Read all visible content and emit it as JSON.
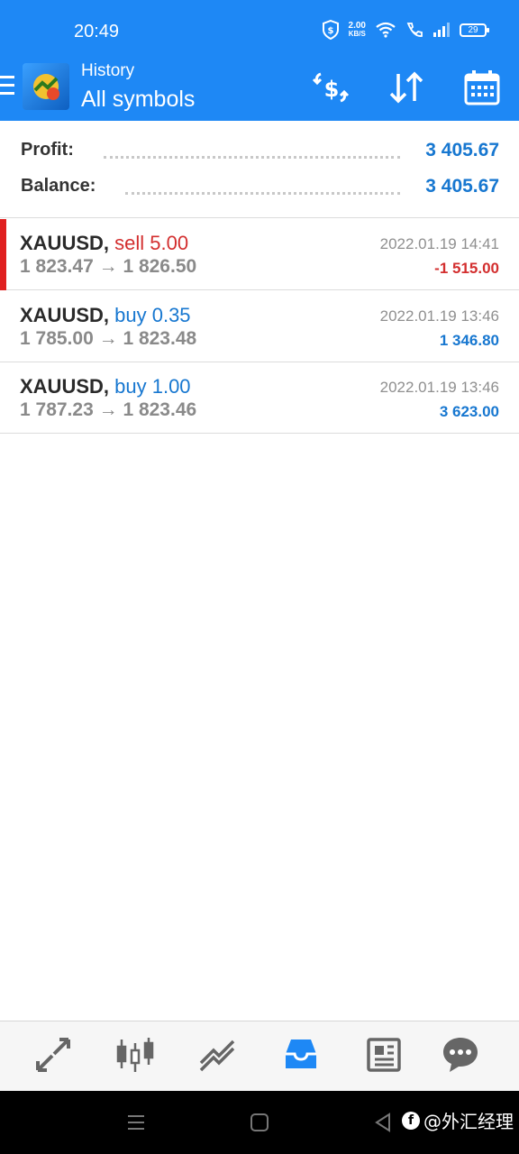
{
  "status_bar": {
    "time": "20:49",
    "net_speed_value": "2.00",
    "net_speed_unit": "KB/S",
    "battery": "29"
  },
  "app_bar": {
    "subtitle": "History",
    "title": "All symbols",
    "icons": [
      "menu-icon",
      "app-logo",
      "currency-exchange-icon",
      "sort-icon",
      "calendar-icon"
    ]
  },
  "summary": {
    "profit_label": "Profit:",
    "profit_value": "3 405.67",
    "balance_label": "Balance:",
    "balance_value": "3 405.67"
  },
  "trades": [
    {
      "symbol": "XAUUSD,",
      "type": "sell 5.00",
      "open_price": "1 823.47",
      "arrow": "→",
      "close_price": "1 826.50",
      "datetime": "2022.01.19 14:41",
      "profit": "-1 515.00",
      "type_color": "#d32f2f",
      "profit_color": "#d32f2f"
    },
    {
      "symbol": "XAUUSD,",
      "type": "buy 0.35",
      "open_price": "1 785.00",
      "arrow": "→",
      "close_price": "1 823.48",
      "datetime": "2022.01.19 13:46",
      "profit": "1 346.80",
      "type_color": "#1777d0",
      "profit_color": "#1777d0"
    },
    {
      "symbol": "XAUUSD,",
      "type": "buy 1.00",
      "open_price": "1 787.23",
      "arrow": "→",
      "close_price": "1 823.46",
      "datetime": "2022.01.19 13:46",
      "profit": "3 623.00",
      "type_color": "#1777d0",
      "profit_color": "#1777d0"
    }
  ],
  "bottom_nav": {
    "items": [
      "quotes-icon",
      "chart-icon",
      "trade-icon",
      "history-icon",
      "news-icon",
      "chat-icon"
    ],
    "active": "history-icon"
  },
  "system_nav": {
    "buttons": [
      "menu-icon",
      "home-icon",
      "back-icon"
    ],
    "watermark": "@外汇经理"
  },
  "colors": {
    "accent": "#1e88f5",
    "profit_positive": "#1777d0",
    "loss": "#d32f2f"
  }
}
